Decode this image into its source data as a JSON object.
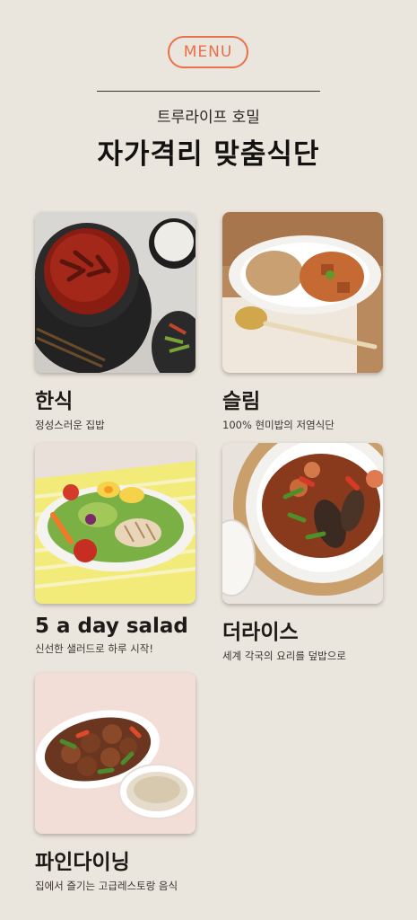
{
  "header": {
    "badge": "MENU",
    "subtitle": "트루라이프 호밀",
    "title": "자가격리 맞춤식단"
  },
  "menu": [
    {
      "title": "한식",
      "desc": "정성스러운 집밥"
    },
    {
      "title": "슬림",
      "desc": "100% 현미밥의 저염식단"
    },
    {
      "title": "5 a day salad",
      "desc": "신선한 샐러드로 하루 시작!"
    },
    {
      "title": "더라이스",
      "desc": "세계 각국의 요리를 덮밥으로"
    },
    {
      "title": "파인다이닝",
      "desc": "집에서 즐기는 고급레스토랑 음식"
    }
  ]
}
